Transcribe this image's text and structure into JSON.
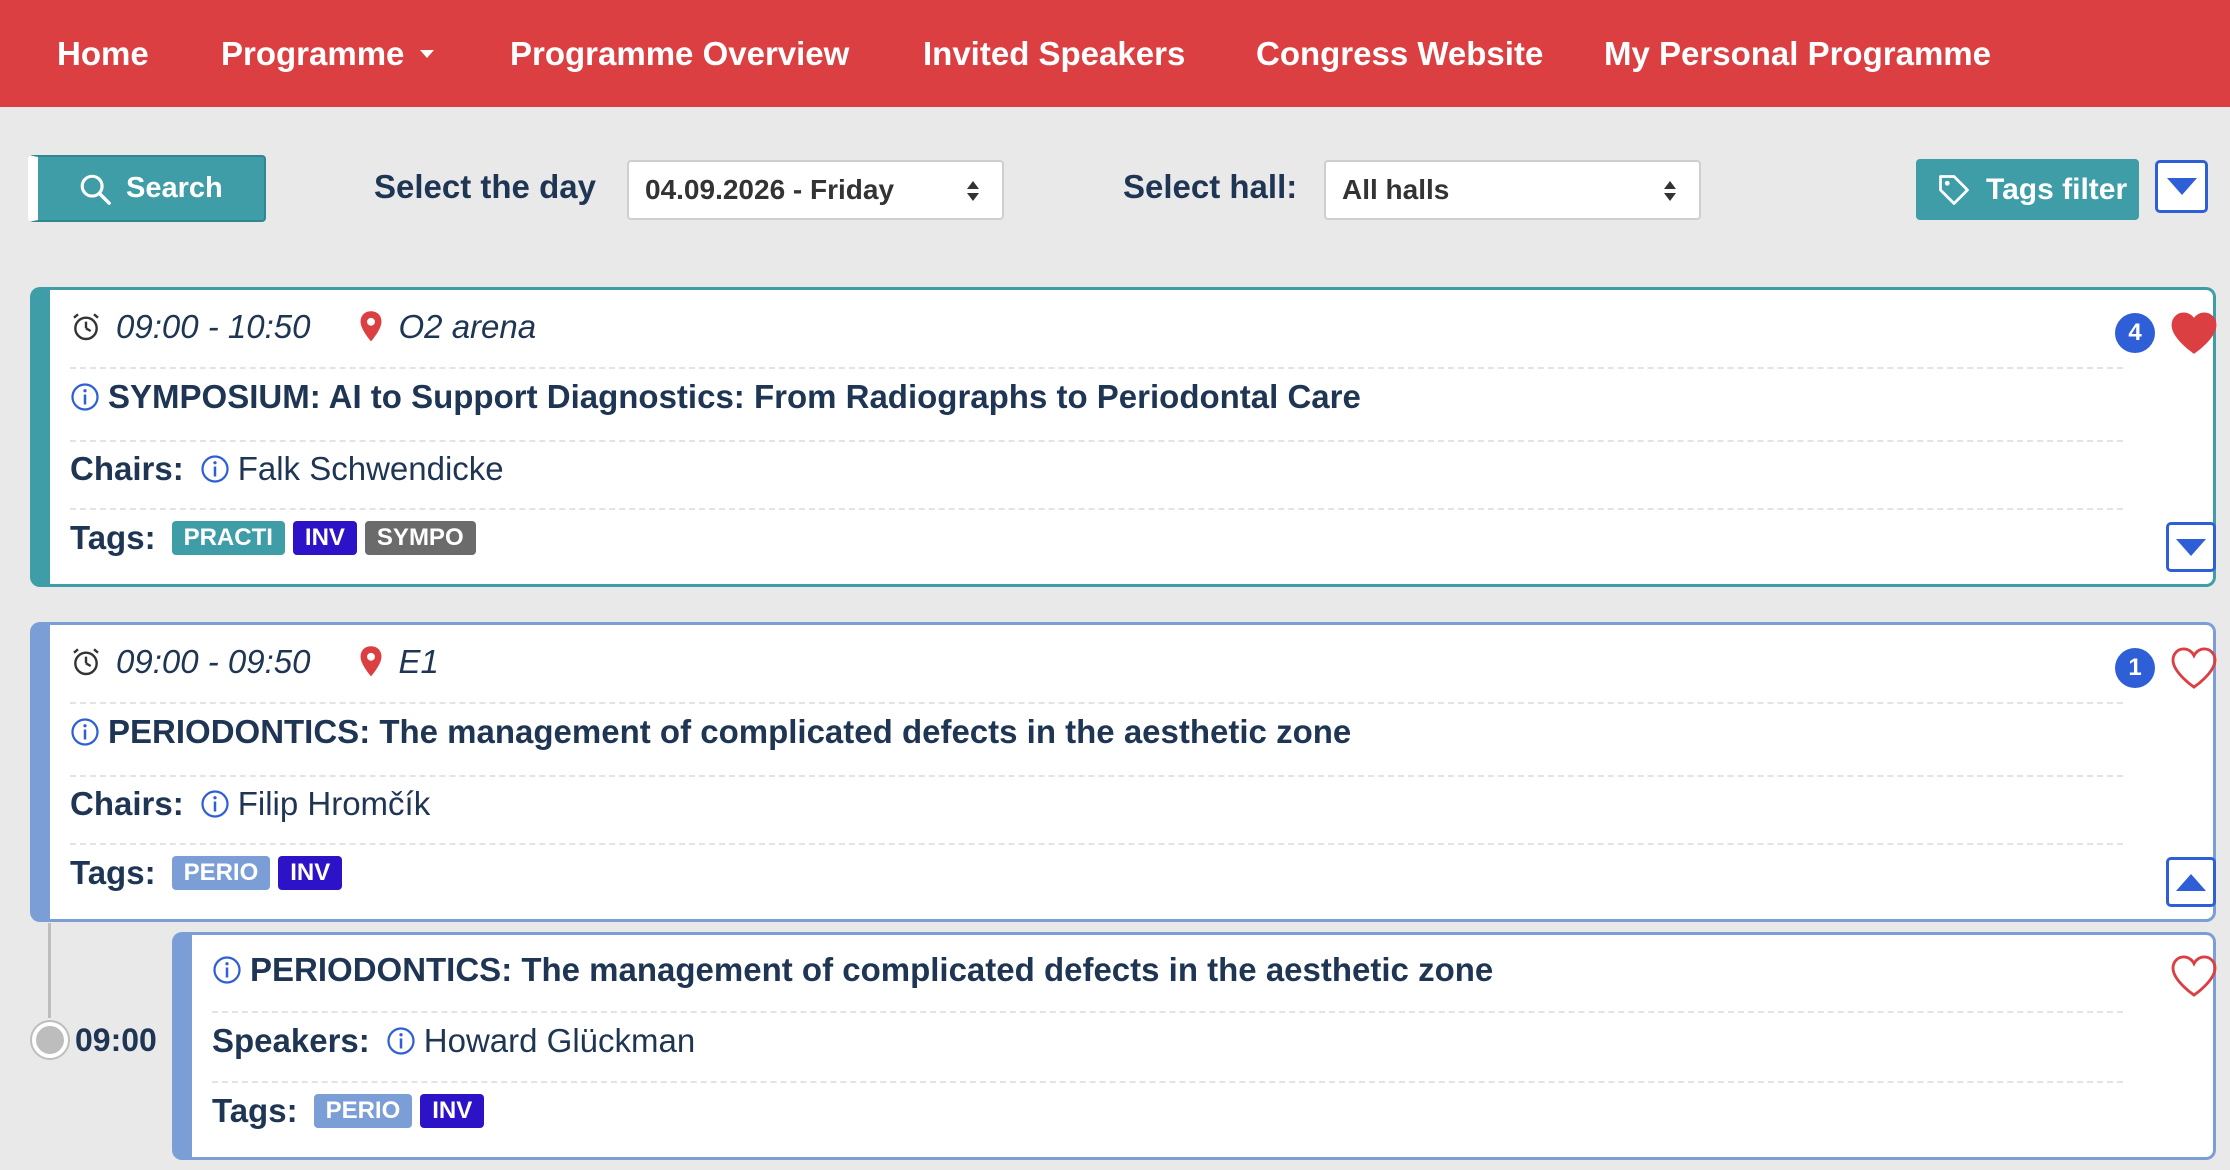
{
  "nav": {
    "home": "Home",
    "programme": "Programme",
    "overview": "Programme Overview",
    "speakers": "Invited Speakers",
    "website": "Congress Website",
    "personal": "My Personal Programme"
  },
  "toolbar": {
    "search_label": "Search",
    "day_label": "Select the day",
    "day_value": "04.09.2026 - Friday",
    "hall_label": "Select hall:",
    "hall_value": "All halls",
    "tags_filter_label": "Tags filter"
  },
  "sessions": [
    {
      "time": "09:00 - 10:50",
      "location": "O2 arena",
      "title": "SYMPOSIUM: AI to Support Diagnostics: From Radiographs to Periodontal Care",
      "chairs_label": "Chairs:",
      "chairs": "Falk Schwendicke",
      "tags_label": "Tags:",
      "tags": [
        "PRACTI",
        "INV",
        "SYMPO"
      ],
      "count": "4",
      "favorited": true
    },
    {
      "time": "09:00 - 09:50",
      "location": "E1",
      "title": "PERIODONTICS: The management of complicated defects in the aesthetic zone",
      "chairs_label": "Chairs:",
      "chairs": "Filip Hromčík",
      "tags_label": "Tags:",
      "tags": [
        "PERIO",
        "INV"
      ],
      "count": "1",
      "favorited": false
    }
  ],
  "sub_item": {
    "time": "09:00",
    "title": "PERIODONTICS: The management of complicated defects in the aesthetic zone",
    "speakers_label": "Speakers:",
    "speakers": "Howard Glückman",
    "tags_label": "Tags:",
    "tags": [
      "PERIO",
      "INV"
    ]
  },
  "colors": {
    "navbar": "#dc3f42",
    "teal": "#3f9da8",
    "tag_practi": "#3f9da8",
    "tag_inv": "#2c13c7",
    "tag_sympo": "#6b6b6b",
    "tag_perio": "#7b9ed6",
    "accent_blue": "#2f5fd6",
    "heart": "#dc3f42"
  },
  "icons": {
    "search": "search-icon",
    "tag": "tag-icon",
    "alarm": "alarm-clock-icon",
    "pin": "map-pin-icon",
    "info": "info-icon",
    "heart": "heart-icon"
  }
}
